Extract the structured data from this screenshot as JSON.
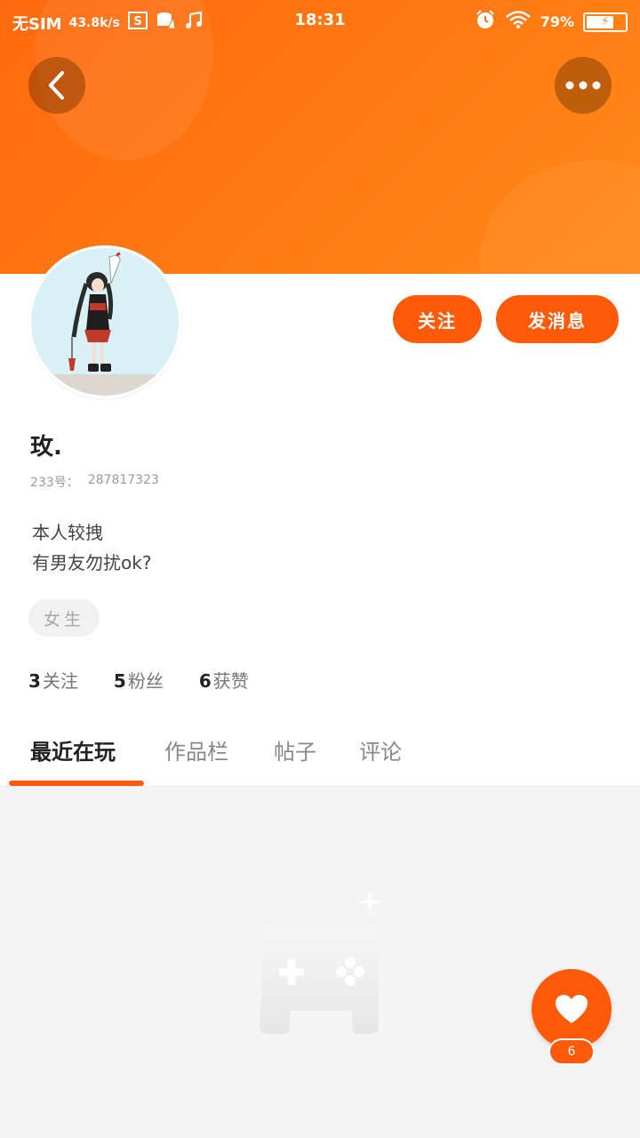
{
  "status_bar": {
    "carrier": "无SIM",
    "net_speed": "43.8k/s",
    "time": "18:31",
    "battery": "79%",
    "battery_level": 0.79
  },
  "header": {
    "back_icon": "chevron-left-icon",
    "more_icon": "more-dots-icon",
    "accent_color": "#ff7a12"
  },
  "profile": {
    "name": "玫.",
    "id_label": "233号：",
    "id_value": "287817323",
    "bio_line1": "本人较拽",
    "bio_line2": "有男友勿扰ok?",
    "gender_tag": "女生"
  },
  "actions": {
    "follow": "关注",
    "message": "发消息",
    "button_color": "#ff5a0a"
  },
  "stats": {
    "following_count": "3",
    "following_label": "关注",
    "fans_count": "5",
    "fans_label": "粉丝",
    "likes_count": "6",
    "likes_label": "获赞"
  },
  "tabs": [
    {
      "label": "最近在玩",
      "active": true
    },
    {
      "label": "作品栏",
      "active": false
    },
    {
      "label": "帖子",
      "active": false
    },
    {
      "label": "评论",
      "active": false
    }
  ],
  "fab": {
    "icon": "heart-icon",
    "count": "6"
  }
}
